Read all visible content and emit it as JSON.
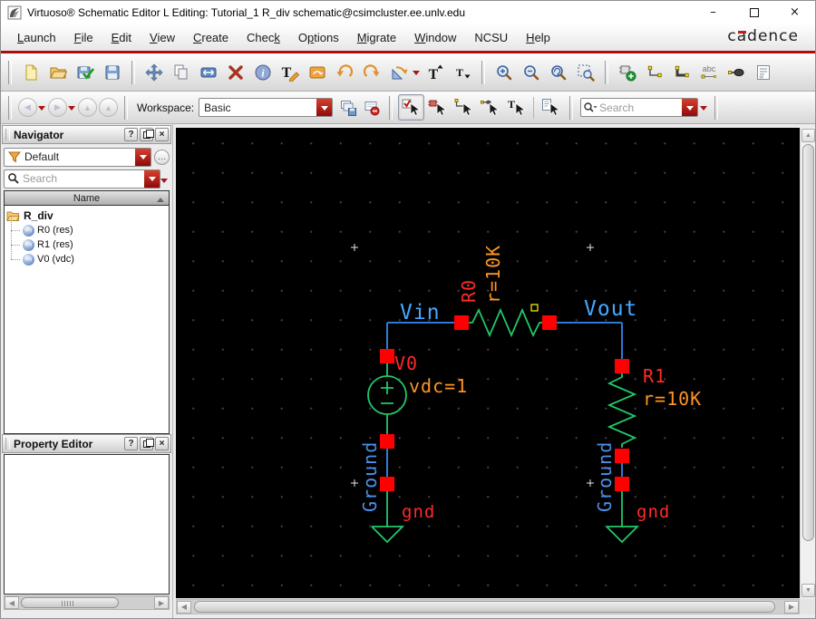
{
  "window": {
    "title": "Virtuoso® Schematic Editor L Editing: Tutorial_1 R_div schematic@csimcluster.ee.unlv.edu",
    "controls": {
      "minimize": "–",
      "close": "×"
    }
  },
  "brand": {
    "logo": "cadence",
    "accent_color": "#c11f1f"
  },
  "menu": {
    "items": [
      {
        "pre": "",
        "key": "L",
        "post": "aunch"
      },
      {
        "pre": "",
        "key": "F",
        "post": "ile"
      },
      {
        "pre": "",
        "key": "E",
        "post": "dit"
      },
      {
        "pre": "",
        "key": "V",
        "post": "iew"
      },
      {
        "pre": "",
        "key": "C",
        "post": "reate"
      },
      {
        "pre": "Chec",
        "key": "k",
        "post": ""
      },
      {
        "pre": "O",
        "key": "p",
        "post": "tions"
      },
      {
        "pre": "",
        "key": "M",
        "post": "igrate"
      },
      {
        "pre": "",
        "key": "W",
        "post": "indow"
      },
      {
        "pre": "NCSU",
        "key": "",
        "post": ""
      },
      {
        "pre": "",
        "key": "H",
        "post": "elp"
      }
    ]
  },
  "toolbar_primary": {
    "icons": [
      "new-cellview",
      "open",
      "check-and-save",
      "save",
      "move",
      "copy",
      "stretch",
      "delete",
      "properties",
      "edit-labels",
      "instance-edit",
      "undo",
      "redo",
      "rotate",
      "ascend",
      "descend",
      "zoom-in",
      "zoom-out",
      "zoom-fit",
      "zoom-to-selected",
      "create-instance",
      "create-wire",
      "create-wide-wire",
      "create-wire-name",
      "create-pin",
      "create-note"
    ]
  },
  "toolbar_secondary": {
    "icons": [
      "back",
      "forward",
      "up",
      "top",
      "save-workspace",
      "revert-workspace",
      "select-all-filter",
      "select-instance-filter",
      "select-wire-filter",
      "select-pin-filter",
      "select-label-filter",
      "query-properties"
    ],
    "workspace_label": "Workspace:",
    "workspace_value": "Basic",
    "search_placeholder": "Search"
  },
  "navigator": {
    "title": "Navigator",
    "help_glyph": "?",
    "close_glyph": "×",
    "filter_value": "Default",
    "more_glyph": "…",
    "search_placeholder": "Search",
    "column_header": "Name",
    "tree": {
      "root": "R_div",
      "children": [
        {
          "label": "R0 (res)"
        },
        {
          "label": "R1 (res)"
        },
        {
          "label": "V0 (vdc)"
        }
      ]
    }
  },
  "property_editor": {
    "title": "Property Editor",
    "help_glyph": "?",
    "close_glyph": "×"
  },
  "schematic": {
    "nets": {
      "vin": "Vin",
      "vout": "Vout",
      "gnd": "gnd"
    },
    "ground_label": "Ground",
    "instances": {
      "r0": {
        "name": "R0",
        "value": "r=10K"
      },
      "r1": {
        "name": "R1",
        "value": "r=10K"
      },
      "v0": {
        "name": "V0",
        "value": "vdc=1"
      }
    },
    "colors": {
      "canvas_bg": "#000000",
      "grid_dot": "#3e3e47",
      "wire_blue": "#2d7ad7",
      "net_label_blue": "#45a7ff",
      "ground_label_blue": "#4d8fe8",
      "component_green": "#1fc96a",
      "selection_red": "#ff0000",
      "instance_label_red": "#ff2a2a",
      "property_orange": "#ff9422",
      "origin_yellow": "#ffff00"
    }
  }
}
